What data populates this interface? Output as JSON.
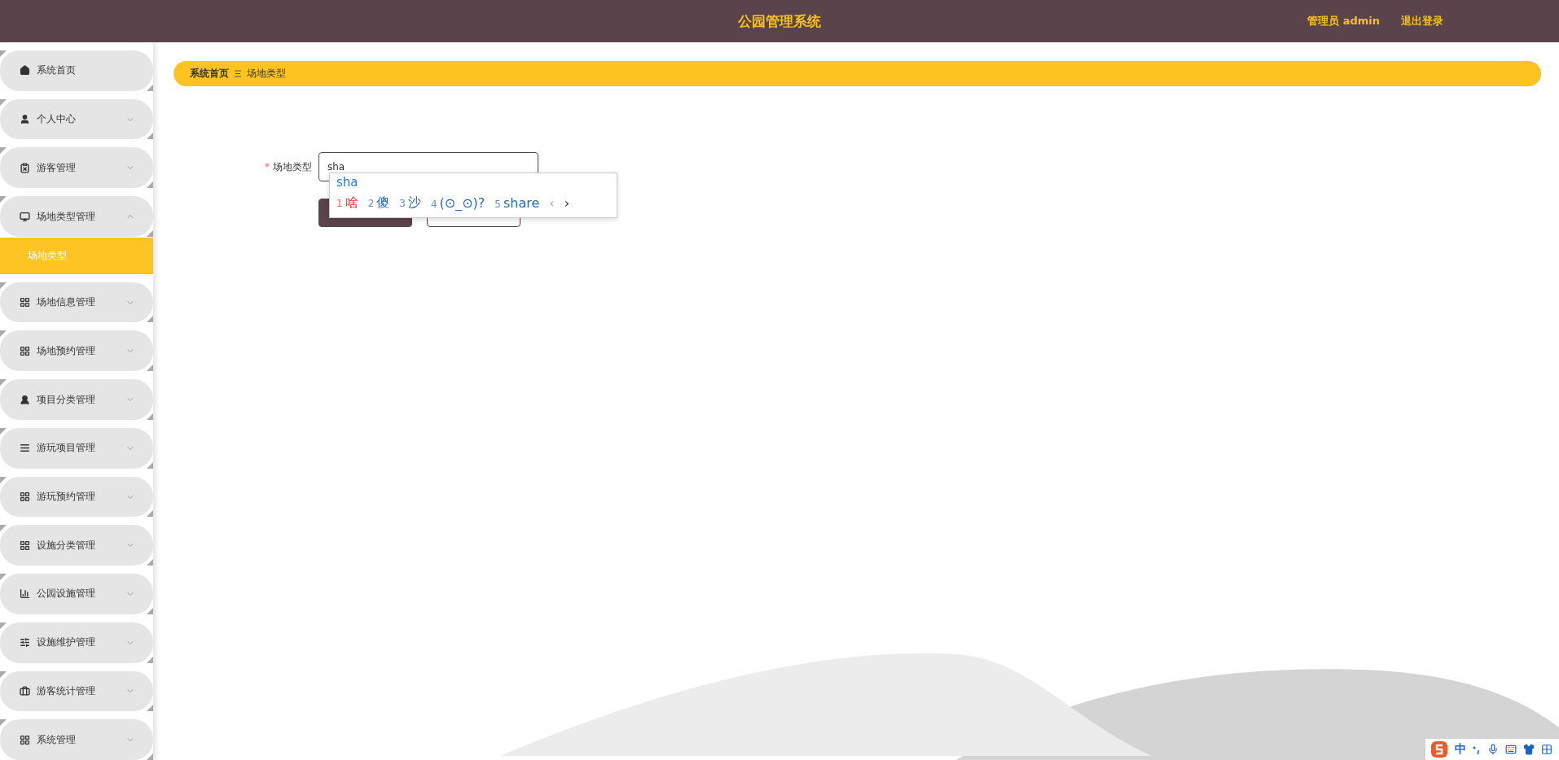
{
  "header": {
    "title": "公园管理系统",
    "user": "管理员 admin",
    "logout": "退出登录"
  },
  "sidebar": {
    "items": [
      {
        "label": "系统首页",
        "kind": "link"
      },
      {
        "label": "个人中心",
        "kind": "menu",
        "expanded": false
      },
      {
        "label": "游客管理",
        "kind": "menu",
        "expanded": false
      },
      {
        "label": "场地类型管理",
        "kind": "menu",
        "expanded": true,
        "children": [
          {
            "label": "场地类型",
            "selected": true
          }
        ]
      },
      {
        "label": "场地信息管理",
        "kind": "menu",
        "expanded": false
      },
      {
        "label": "场地预约管理",
        "kind": "menu",
        "expanded": false
      },
      {
        "label": "项目分类管理",
        "kind": "menu",
        "expanded": false
      },
      {
        "label": "游玩项目管理",
        "kind": "menu",
        "expanded": false
      },
      {
        "label": "游玩预约管理",
        "kind": "menu",
        "expanded": false
      },
      {
        "label": "设施分类管理",
        "kind": "menu",
        "expanded": false
      },
      {
        "label": "公园设施管理",
        "kind": "menu",
        "expanded": false
      },
      {
        "label": "设施维护管理",
        "kind": "menu",
        "expanded": false
      },
      {
        "label": "游客统计管理",
        "kind": "menu",
        "expanded": false
      },
      {
        "label": "系统管理",
        "kind": "menu",
        "expanded": false
      }
    ]
  },
  "breadcrumb": [
    {
      "label": "系统首页"
    },
    {
      "label": "场地类型"
    }
  ],
  "form": {
    "field": {
      "label": "场地类型",
      "required_mark": "*",
      "value": "sha"
    }
  },
  "ime_popup": {
    "composition": "sha",
    "candidates": [
      {
        "index": "1",
        "text": "啥",
        "selected": true
      },
      {
        "index": "2",
        "text": "傻",
        "selected": false
      },
      {
        "index": "3",
        "text": "沙",
        "selected": false
      },
      {
        "index": "4",
        "text": "(⊙_⊙)?",
        "selected": false
      },
      {
        "index": "5",
        "text": "share",
        "selected": false
      }
    ],
    "pager": [
      {
        "label": "‹",
        "disabled": true
      },
      {
        "label": "›",
        "disabled": false
      }
    ]
  },
  "ime_toolbar": {
    "mode": "中"
  }
}
